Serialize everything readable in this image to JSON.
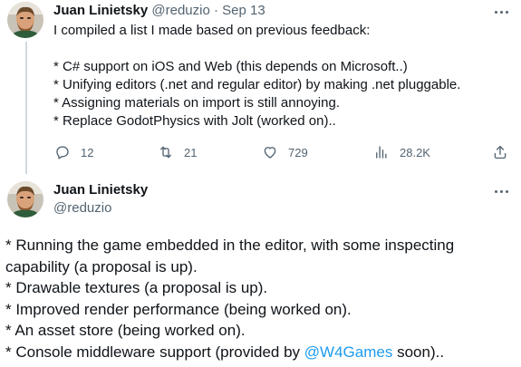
{
  "tweet1": {
    "author_name": "Juan Linietsky",
    "handle": "@reduzio",
    "separator": "·",
    "date": "Sep 13",
    "lines": [
      "I compiled a list I made based on previous feedback:",
      "",
      "* C# support on iOS and Web (this depends on Microsoft..)",
      "* Unifying editors (.net and regular editor) by making .net pluggable.",
      "* Assigning materials on import is still annoying.",
      "* Replace GodotPhysics with Jolt (worked on).."
    ],
    "actions": {
      "replies": "12",
      "reposts": "21",
      "likes": "729",
      "views": "28.2K"
    },
    "icons": [
      "reply-icon",
      "repost-icon",
      "like-icon",
      "views-icon",
      "share-icon",
      "more-icon"
    ]
  },
  "tweet2": {
    "author_name": "Juan Linietsky",
    "handle": "@reduzio",
    "lines": [
      "* Running the game embedded in the editor, with some inspecting",
      "capability (a proposal is up).",
      "* Drawable textures (a proposal is up).",
      "* Improved render performance (being worked on).",
      "* An asset store (being worked on)."
    ],
    "last_line_prefix": "* Console middleware support (provided by ",
    "mention": "@W4Games",
    "last_line_suffix": " soon).."
  },
  "colors": {
    "text": "#0f1419",
    "secondary": "#536471",
    "link": "#1d9bf0",
    "thread_line": "#cfd9de"
  }
}
